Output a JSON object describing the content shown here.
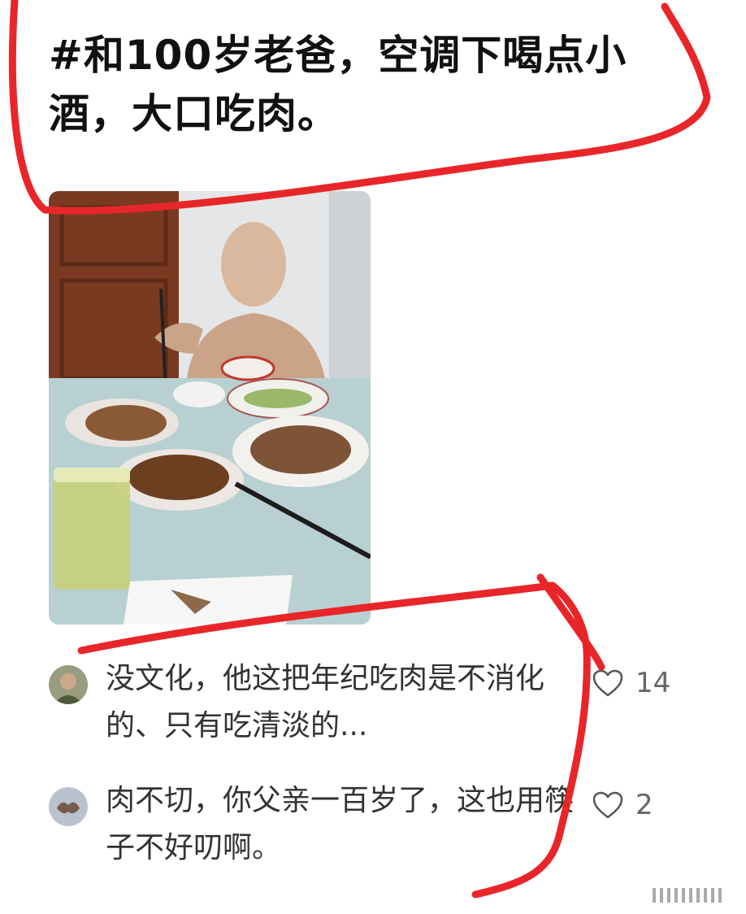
{
  "post": {
    "title": "#和100岁老爸，空调下喝点小酒，大口吃肉。"
  },
  "comments": [
    {
      "text": "没文化，他这把年纪吃肉是不消化的、只有吃清淡的...",
      "likes": "14"
    },
    {
      "text": "肉不切，你父亲一百岁了，这也用筷子不好叨啊。",
      "likes": "2"
    }
  ],
  "colors": {
    "annotation": "#e8262a",
    "text": "#111111",
    "comment_text": "#333333"
  },
  "icons": {
    "like": "heart-outline-icon"
  }
}
